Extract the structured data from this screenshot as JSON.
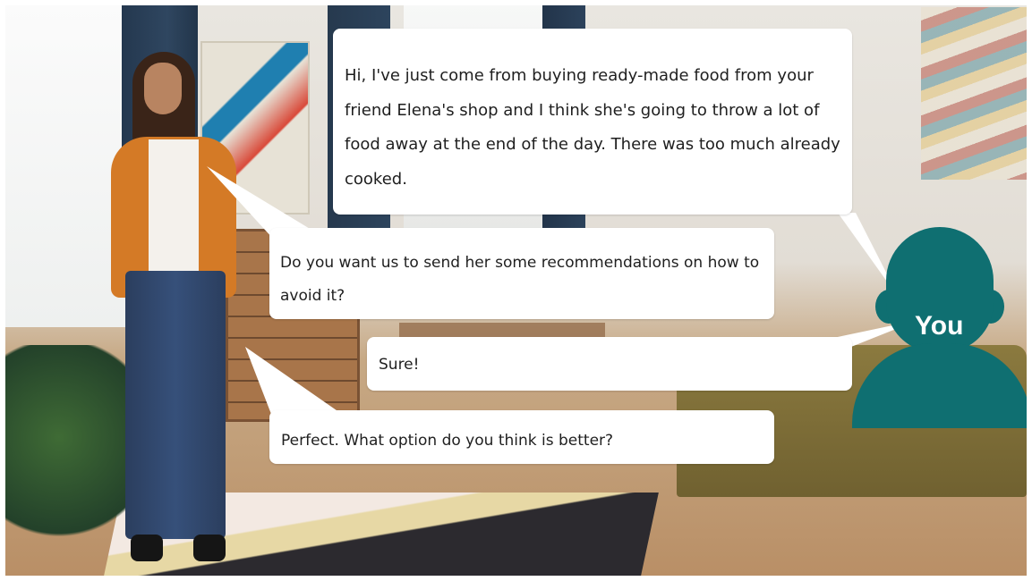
{
  "scene": {
    "avatar_label": "You"
  },
  "dialogue": {
    "speaker_line_1": "Hi, I've just come from buying ready-made food from your friend Elena's shop and I think she's going to throw a lot of food away at the end of the day. There was too much already cooked.",
    "character_line_1": "Do you want us to send her some recommendations on how to avoid it?",
    "player_reply": "Sure!",
    "character_line_2": "Perfect. What option do you think is better?"
  },
  "colors": {
    "avatar_teal": "#0f6f71",
    "bubble_bg": "#ffffff"
  }
}
